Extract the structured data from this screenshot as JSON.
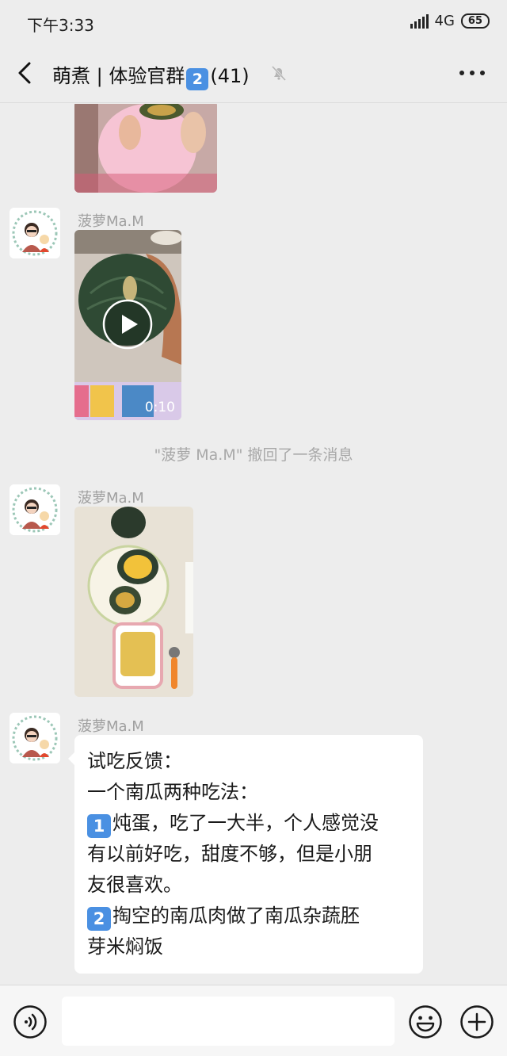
{
  "status_bar": {
    "time": "下午3:33",
    "network": "4G",
    "battery": "65"
  },
  "header": {
    "title": "萌煮 | 体验官群",
    "group_number": "2",
    "member_count": "(41)"
  },
  "messages": [
    {
      "sender": "菠萝Ma.M",
      "type": "video",
      "duration": "0:10"
    },
    {
      "system": "\"菠萝 Ma.M\" 撤回了一条消息"
    },
    {
      "sender": "菠萝Ma.M",
      "type": "image"
    },
    {
      "sender": "菠萝Ma.M",
      "type": "text",
      "lines": [
        {
          "prefix": "",
          "text": "试吃反馈："
        },
        {
          "prefix": "",
          "text": "一个南瓜两种吃法："
        },
        {
          "prefix": "1",
          "text": "炖蛋，吃了一大半，个人感觉没"
        },
        {
          "prefix": "",
          "text": "有以前好吃，甜度不够，但是小朋"
        },
        {
          "prefix": "",
          "text": "友很喜欢。"
        },
        {
          "prefix": "2",
          "text": "掏空的南瓜肉做了南瓜杂蔬胚"
        },
        {
          "prefix": "",
          "text": "芽米焖饭"
        }
      ]
    }
  ],
  "input": {
    "value": "",
    "placeholder": ""
  },
  "icons": {
    "back": "chevron-left-icon",
    "mute": "bell-muted-icon",
    "more": "ellipsis-icon",
    "voice": "voice-icon",
    "emoji": "smiley-icon",
    "plus": "plus-icon",
    "play": "play-icon"
  },
  "colors": {
    "background": "#ededed",
    "bubble": "#ffffff",
    "keycap": "#4a90e2",
    "sender": "#a0a0a0",
    "system": "#a8a8a8"
  }
}
